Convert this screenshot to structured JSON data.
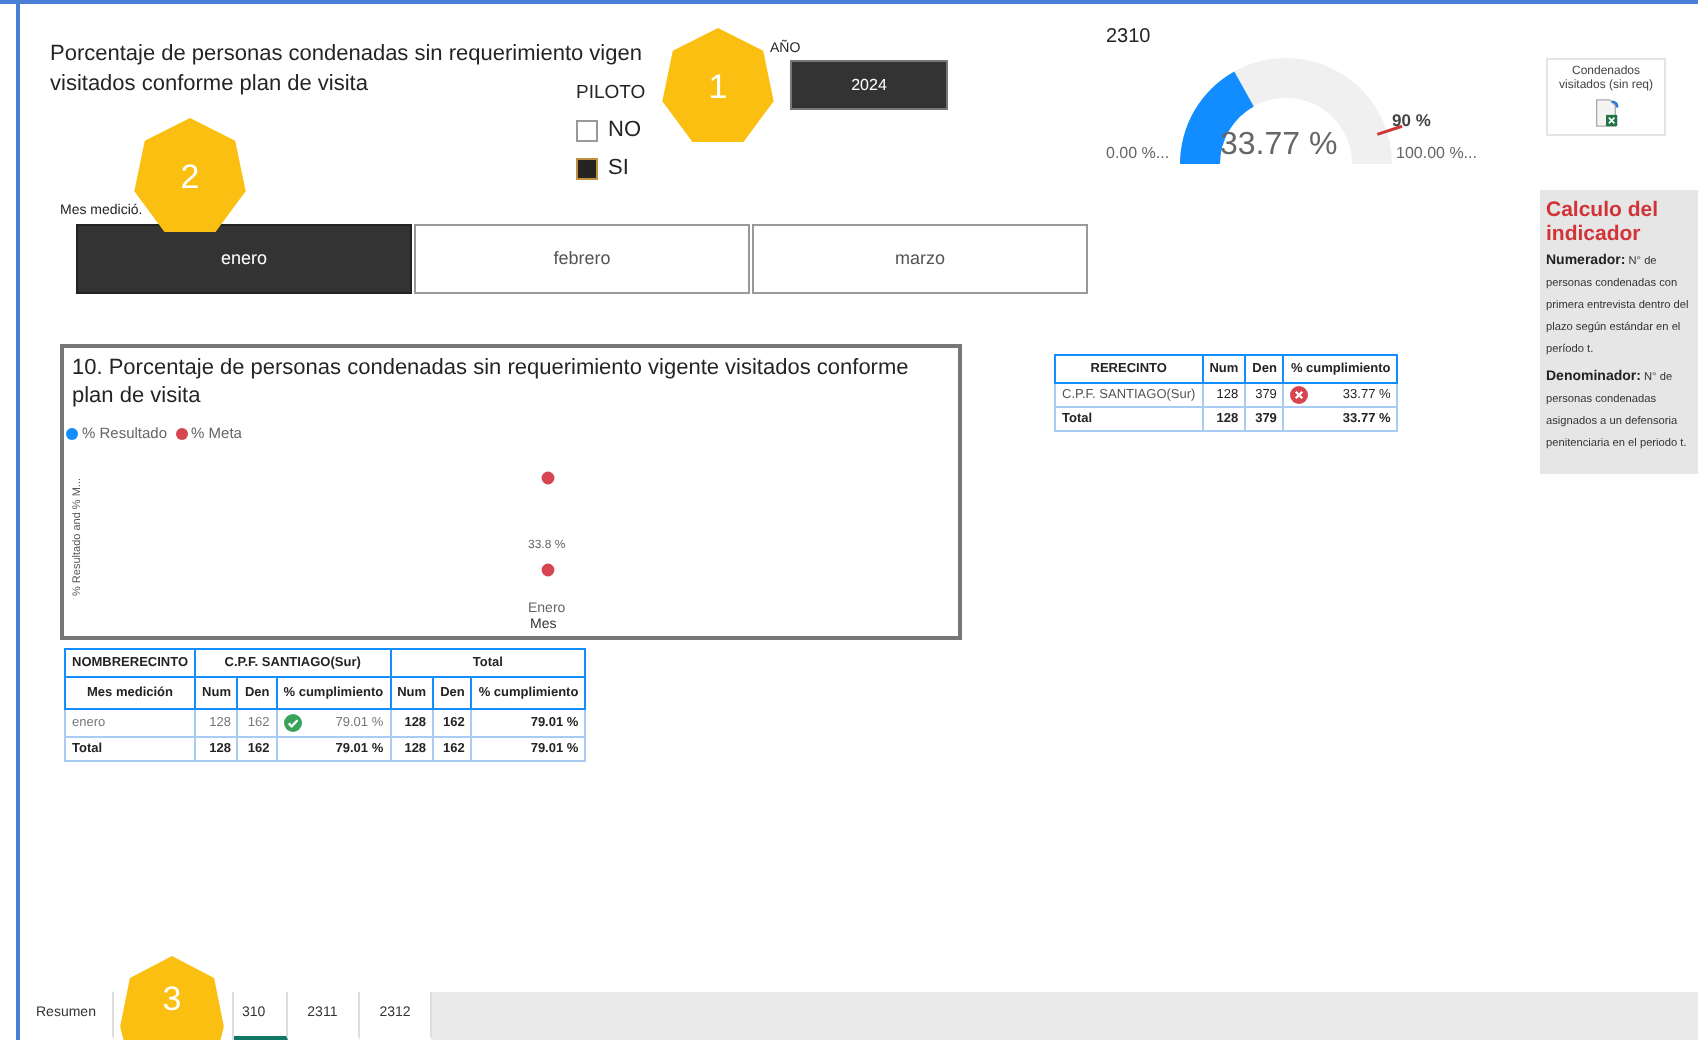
{
  "report": {
    "title_lines": [
      "Porcentaje de personas condenadas sin requerimiento vigen",
      "visitados conforme plan de visita"
    ]
  },
  "year_slicer": {
    "label": "AÑO",
    "value": "2024"
  },
  "piloto": {
    "label": "PILOTO",
    "options": [
      {
        "label": "NO",
        "checked": false
      },
      {
        "label": "SI",
        "checked": true
      }
    ]
  },
  "month_slicer": {
    "label": "Mes medició.",
    "options": [
      {
        "label": "enero",
        "selected": true
      },
      {
        "label": "febrero",
        "selected": false
      },
      {
        "label": "marzo",
        "selected": false
      }
    ]
  },
  "gauge": {
    "title": "2310",
    "value": "33.77 %",
    "level": 0.3377,
    "min_label": "0.00 %...",
    "max_label": "100.00 %...",
    "target": {
      "label": "90 %",
      "level": 0.9
    }
  },
  "export_button": {
    "label": "Condenados visitados (sin req)"
  },
  "calc_panel": {
    "title": "Calculo del indicador",
    "paragraphs": [
      "**Numerador:** N° de personas condenadas con primera entrevista dentro del plazo según estándar en el período t.",
      "**Denominador:** N° de personas condenadas asignados a un defensoria penitenciaria en el periodo t."
    ]
  },
  "chart": {
    "title": "10. Porcentaje de personas condenadas sin requerimiento vigente visitados conforme plan de visita",
    "legend": [
      {
        "label": "% Resultado",
        "color": "#118dff"
      },
      {
        "label": "% Meta",
        "color": "#d64550"
      }
    ],
    "y_axis_title": "% Resultado and % M...",
    "data_label": "33.8 %",
    "category": "Enero",
    "x_axis_title": "Mes"
  },
  "summary_table": {
    "columns": [
      "RERECINTO",
      "Num",
      "Den",
      "% cumplimiento"
    ],
    "rows": [
      {
        "cells": [
          "C.P.F. SANTIAGO(Sur)",
          "128",
          "379",
          "33.77 %"
        ],
        "met": false
      }
    ],
    "total": [
      "Total",
      "128",
      "379",
      "33.77 %"
    ]
  },
  "detail_table": {
    "group_headers": [
      "NOMBRERECINTO",
      "C.P.F. SANTIAGO(Sur)",
      "Total"
    ],
    "columns": [
      "Mes medición",
      "Num",
      "Den",
      "% cumplimiento",
      "Num",
      "Den",
      "% cumplimiento"
    ],
    "rows": [
      {
        "cells": [
          "enero",
          "128",
          "162",
          "79.01 %",
          "128",
          "162",
          "79.01 %"
        ],
        "met": true
      }
    ],
    "total": [
      "Total",
      "128",
      "162",
      "79.01 %",
      "128",
      "162",
      "79.01 %"
    ]
  },
  "callouts": [
    "1",
    "2",
    "3"
  ],
  "page_tabs": [
    {
      "label": "Resumen",
      "selected": false
    },
    {
      "label": "310",
      "selected": true
    },
    {
      "label": "2311",
      "selected": false
    },
    {
      "label": "2312",
      "selected": false
    }
  ]
}
